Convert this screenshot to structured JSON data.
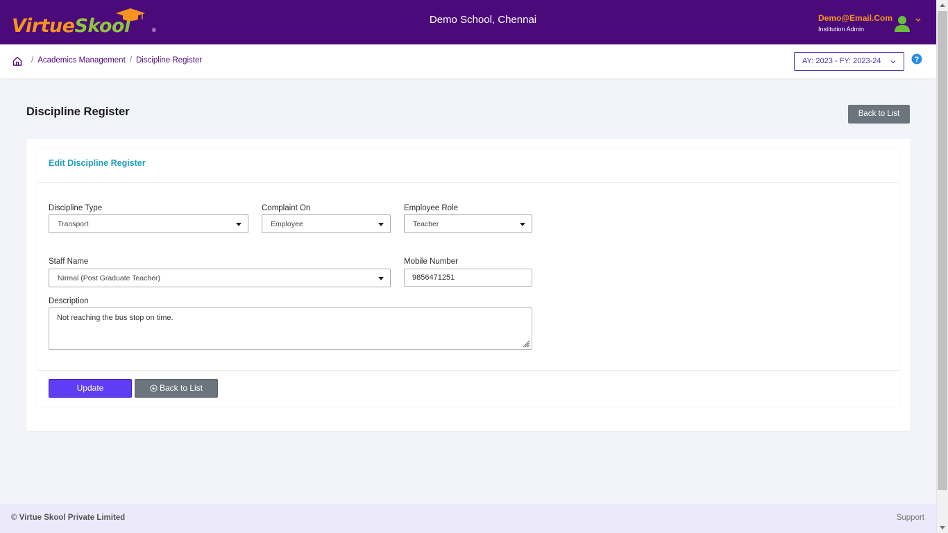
{
  "header": {
    "logo_virtue": "Virtue",
    "logo_skool": "Skool",
    "logo_reg": "®",
    "school": "Demo School, Chennai",
    "user_email": "Demo@Email.Com",
    "user_role": "Institution Admin"
  },
  "breadcrumb": {
    "items": [
      "Academics Management",
      "Discipline Register"
    ],
    "separator": "/"
  },
  "academic_year": {
    "selected": "AY: 2023 - FY: 2023-24"
  },
  "page": {
    "title": "Discipline Register",
    "back_top_label": "Back to List"
  },
  "form": {
    "card_title": "Edit Discipline Register",
    "discipline_type": {
      "label": "Discipline Type",
      "value": "Transport"
    },
    "complaint_on": {
      "label": "Complaint On",
      "value": "Employee"
    },
    "employee_role": {
      "label": "Employee Role",
      "value": "Teacher"
    },
    "staff_name": {
      "label": "Staff Name",
      "value": "Nirmal (Post Graduate Teacher)"
    },
    "mobile_number": {
      "label": "Mobile Number",
      "value": "9856471251"
    },
    "description": {
      "label": "Description",
      "value": "Not reaching the bus stop on time."
    },
    "update_label": "Update",
    "back_label": "Back to List"
  },
  "footer": {
    "copyright": "© Virtue Skool Private Limited",
    "support": "Support"
  },
  "colors": {
    "header_bg": "#4b0a7a",
    "accent_orange": "#f7941d",
    "accent_green": "#8dc63f",
    "primary_button": "#5f3df5",
    "secondary_button": "#6c757d",
    "card_title": "#1ea0b8",
    "footer_bg": "#ece9fb"
  },
  "icons": {
    "home": "home-icon",
    "avatar": "user-avatar-icon",
    "help": "help-icon",
    "back": "circle-arrow-left-icon",
    "logo_cap": "graduation-cap-icon"
  }
}
